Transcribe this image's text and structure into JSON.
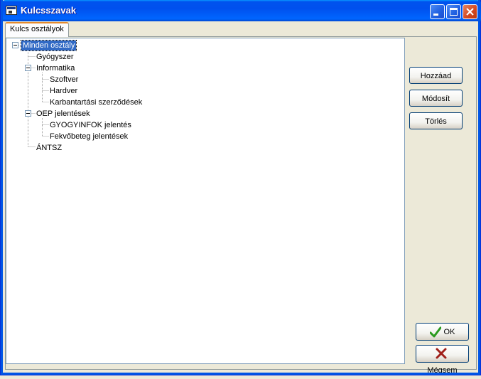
{
  "window": {
    "title": "Kulcsszavak"
  },
  "tabs": [
    {
      "label": "Kulcs osztályok"
    }
  ],
  "tree": {
    "nodes": [
      {
        "label": "Minden osztály",
        "level": 0,
        "expanded": true,
        "selected": true
      },
      {
        "label": "Gyógyszer",
        "level": 1
      },
      {
        "label": "Informatika",
        "level": 1,
        "expanded": true
      },
      {
        "label": "Szoftver",
        "level": 2
      },
      {
        "label": "Hardver",
        "level": 2
      },
      {
        "label": "Karbantartási szerződések",
        "level": 2
      },
      {
        "label": "OEP jelentések",
        "level": 1,
        "expanded": true
      },
      {
        "label": "GYOGYINFOK jelentés",
        "level": 2
      },
      {
        "label": "Fekvőbeteg jelentések",
        "level": 2
      },
      {
        "label": "ÁNTSZ",
        "level": 1
      }
    ]
  },
  "buttons": {
    "add": "Hozzáad",
    "modify": "Módosít",
    "delete": "Törlés",
    "ok": "OK",
    "cancel": "Mégsem"
  },
  "icons": {
    "ok": "checkmark-icon",
    "cancel": "x-icon"
  },
  "colors": {
    "titlebar": "#0053ee",
    "selection": "#316ac5",
    "ok_green": "#2a9a1e",
    "cancel_red": "#a0201a"
  }
}
